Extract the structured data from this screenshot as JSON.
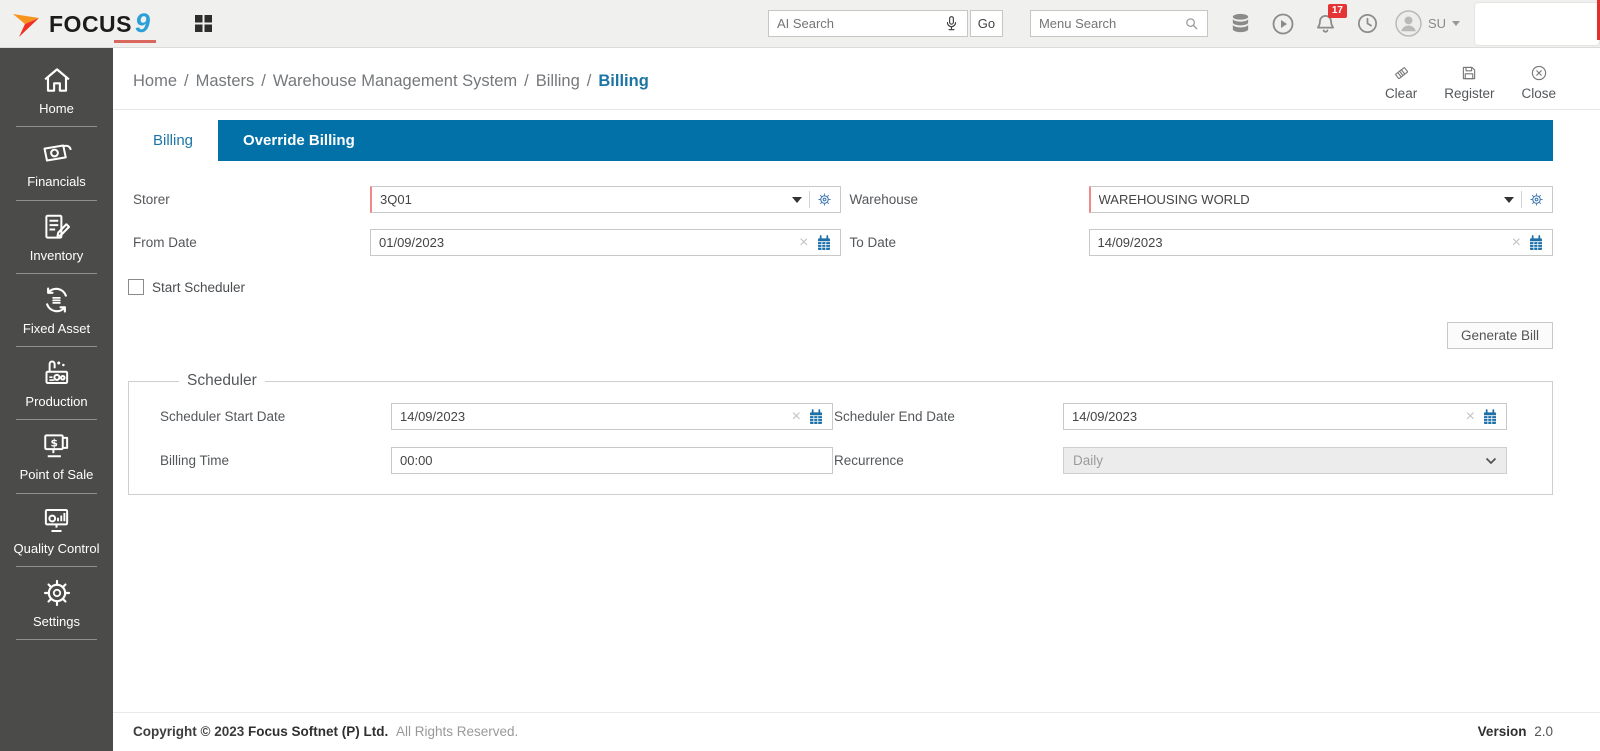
{
  "header": {
    "logo": {
      "brand": "FOCUS",
      "nine": "9"
    },
    "ai_search_placeholder": "AI Search",
    "go_label": "Go",
    "menu_search_placeholder": "Menu Search",
    "notification_count": "17",
    "user_initials": "SU"
  },
  "sidebar": {
    "items": [
      {
        "label": "Home",
        "icon": "home-icon"
      },
      {
        "label": "Financials",
        "icon": "financials-icon"
      },
      {
        "label": "Inventory",
        "icon": "inventory-icon"
      },
      {
        "label": "Fixed Asset",
        "icon": "fixed-asset-icon"
      },
      {
        "label": "Production",
        "icon": "production-icon"
      },
      {
        "label": "Point of Sale",
        "icon": "point-of-sale-icon"
      },
      {
        "label": "Quality Control",
        "icon": "quality-control-icon"
      },
      {
        "label": "Settings",
        "icon": "settings-icon"
      }
    ]
  },
  "breadcrumb": {
    "separator": "/",
    "items": [
      "Home",
      "Masters",
      "Warehouse Management System",
      "Billing"
    ],
    "current": "Billing"
  },
  "doc_actions": {
    "clear": "Clear",
    "register": "Register",
    "close": "Close"
  },
  "tabs": [
    {
      "label": "Billing",
      "active": true
    },
    {
      "label": "Override Billing",
      "active": false
    }
  ],
  "form": {
    "storer": {
      "label": "Storer",
      "value": "3Q01"
    },
    "warehouse": {
      "label": "Warehouse",
      "value": "WAREHOUSING WORLD"
    },
    "from_date": {
      "label": "From Date",
      "value": "01/09/2023"
    },
    "to_date": {
      "label": "To Date",
      "value": "14/09/2023"
    },
    "start_scheduler_label": "Start Scheduler",
    "generate_bill_label": "Generate Bill"
  },
  "scheduler": {
    "legend": "Scheduler",
    "start_date": {
      "label": "Scheduler Start Date",
      "value": "14/09/2023"
    },
    "end_date": {
      "label": "Scheduler End Date",
      "value": "14/09/2023"
    },
    "billing_time": {
      "label": "Billing Time",
      "value": "00:00"
    },
    "recurrence": {
      "label": "Recurrence",
      "value": "Daily"
    }
  },
  "footer": {
    "copyright": "Copyright © 2023",
    "company": "Focus Softnet (P) Ltd.",
    "rights": "All Rights Reserved.",
    "version_label": "Version",
    "version_value": "2.0"
  },
  "colors": {
    "accent_blue": "#0271a8",
    "breadcrumb_active_blue": "#1c75a5",
    "required_red": "#f08a8a",
    "badge_red": "#e53434",
    "calendar_blue": "#1d6fa8",
    "sidebar_bg": "#4b4b4a",
    "header_bg": "#f0f0ee"
  }
}
